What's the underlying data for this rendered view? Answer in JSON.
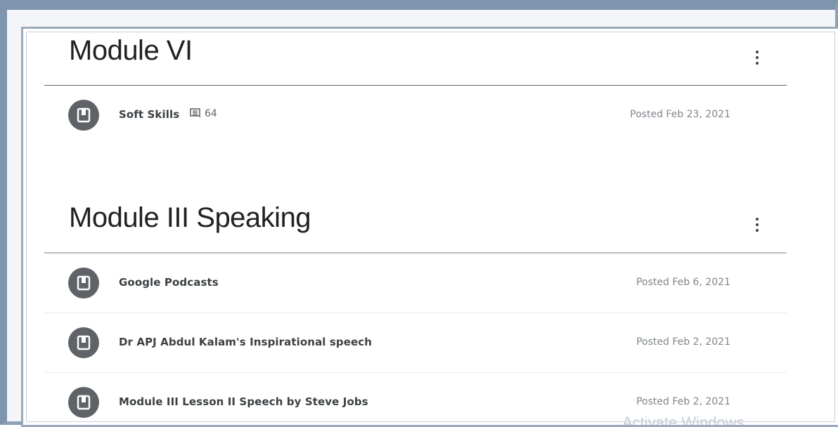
{
  "topics": [
    {
      "title": "Module VI",
      "menu_icon": "more-vert-icon",
      "items": [
        {
          "title": "Soft Skills",
          "comment_count": "64",
          "date": "Posted Feb 23, 2021",
          "icon": "material-icon"
        }
      ]
    },
    {
      "title": "Module III Speaking",
      "menu_icon": "more-vert-icon",
      "items": [
        {
          "title": "Google Podcasts",
          "date": "Posted Feb 6, 2021",
          "icon": "material-icon"
        },
        {
          "title": "Dr APJ Abdul Kalam's Inspirational speech",
          "date": "Posted Feb 2, 2021",
          "icon": "material-icon"
        },
        {
          "title": "Module III Lesson II Speech by Steve Jobs",
          "date": "Posted Feb 2, 2021",
          "icon": "material-icon"
        }
      ]
    }
  ],
  "watermark": "Activate Windows",
  "colors": {
    "frame": "#7f94ad",
    "icon_bg": "#5f6368",
    "title_text": "#202124",
    "date_text": "#80868b"
  }
}
